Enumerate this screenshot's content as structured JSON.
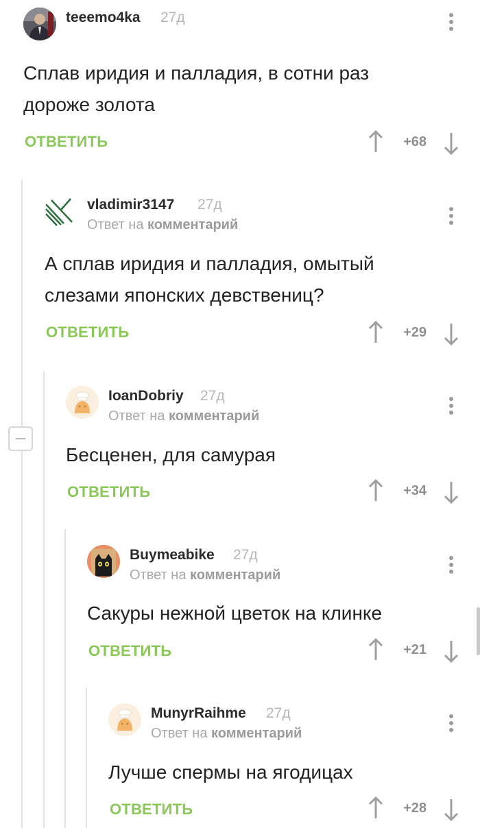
{
  "accent_color": "#8ac858",
  "comments": [
    {
      "username": "teeemo4ka",
      "time": "27д",
      "reply_prefix": "",
      "reply_target": "",
      "text": "Сплав иридия и палладия, в сотни раз дороже золота",
      "reply_label": "ОТВЕТИТЬ",
      "rating": "+68",
      "avatar": "photo-avatar"
    },
    {
      "username": "vladimir3147",
      "time": "27д",
      "reply_prefix": "Ответ на",
      "reply_target": "комментарий",
      "text": "А сплав иридия и палладия, омытый слезами японских девствениц?",
      "reply_label": "ОТВЕТИТЬ",
      "rating": "+29",
      "avatar": "green-stripes-avatar"
    },
    {
      "username": "IoanDobriy",
      "time": "27д",
      "reply_prefix": "Ответ на",
      "reply_target": "комментарий",
      "text": "Бесценен, для самурая",
      "reply_label": "ОТВЕТИТЬ",
      "rating": "+34",
      "avatar": "default-pikabu-avatar"
    },
    {
      "username": "Buymeabike",
      "time": "27д",
      "reply_prefix": "Ответ на",
      "reply_target": "комментарий",
      "text": "Сакуры нежной цветок на клинке",
      "reply_label": "ОТВЕТИТЬ",
      "rating": "+21",
      "avatar": "black-cat-avatar"
    },
    {
      "username": "MunyrRaihme",
      "time": "27д",
      "reply_prefix": "Ответ на",
      "reply_target": "комментарий",
      "text": "Лучше спермы на ягодицах",
      "reply_label": "ОТВЕТИТЬ",
      "rating": "+28",
      "avatar": "default-pikabu-avatar"
    }
  ]
}
